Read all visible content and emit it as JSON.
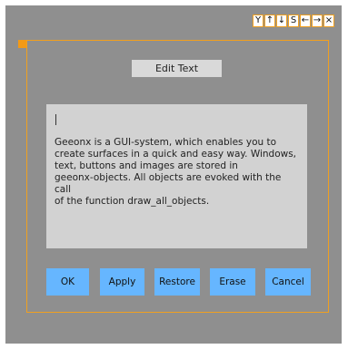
{
  "toolbar": {
    "icons": {
      "fork": "Y",
      "up": "↑",
      "down": "↓",
      "s": "S",
      "left": "←",
      "right": "→",
      "close": "×"
    }
  },
  "window": {
    "title": "Edit Text",
    "text": "Geeonx is a GUI-system, which enables you to\ncreate surfaces in a quick and easy way. Windows,\ntext, buttons and images are stored in\ngeeonx-objects. All objects are evoked with the call\nof the function draw_all_objects."
  },
  "buttons": {
    "ok": "OK",
    "apply": "Apply",
    "restore": "Restore",
    "erase": "Erase",
    "cancel": "Cancel"
  },
  "colors": {
    "panel": "#8f8f8f",
    "accent": "#f0a020",
    "button": "#66b6ff",
    "title_bg": "#d9d9d9",
    "text_bg": "#d2d2d2"
  }
}
